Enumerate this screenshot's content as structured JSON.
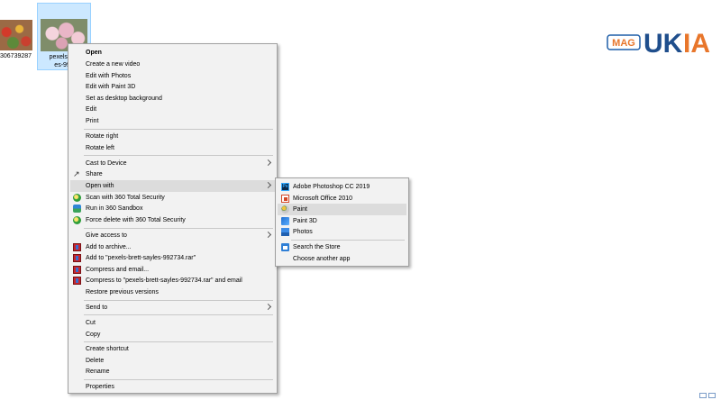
{
  "files": [
    {
      "name": "306739287"
    },
    {
      "name": "pexels-bre\nes-992"
    }
  ],
  "logo": {
    "text_mag": "MAG",
    "text_brand": "UKIA"
  },
  "context_menu": {
    "items": [
      {
        "label": "Open",
        "bold": true
      },
      {
        "label": "Create a new video"
      },
      {
        "label": "Edit with Photos"
      },
      {
        "label": "Edit with Paint 3D"
      },
      {
        "label": "Set as desktop background"
      },
      {
        "label": "Edit"
      },
      {
        "label": "Print"
      },
      {
        "label": "Rotate right"
      },
      {
        "label": "Rotate left"
      },
      {
        "label": "Cast to Device"
      },
      {
        "label": "Share"
      },
      {
        "label": "Open with"
      },
      {
        "label": "Scan with 360 Total Security"
      },
      {
        "label": "Run in 360 Sandbox"
      },
      {
        "label": "Force delete with 360 Total Security"
      },
      {
        "label": "Give access to"
      },
      {
        "label": "Add to archive..."
      },
      {
        "label": "Add to \"pexels-brett-sayles-992734.rar\""
      },
      {
        "label": "Compress and email..."
      },
      {
        "label": "Compress to \"pexels-brett-sayles-992734.rar\" and email"
      },
      {
        "label": "Restore previous versions"
      },
      {
        "label": "Send to"
      },
      {
        "label": "Cut"
      },
      {
        "label": "Copy"
      },
      {
        "label": "Create shortcut"
      },
      {
        "label": "Delete"
      },
      {
        "label": "Rename"
      },
      {
        "label": "Properties"
      }
    ]
  },
  "open_with_submenu": {
    "items": [
      {
        "label": "Adobe Photoshop CC 2019",
        "icon": "photoshop-icon"
      },
      {
        "label": "Microsoft Office 2010",
        "icon": "office-icon"
      },
      {
        "label": "Paint",
        "icon": "paint-icon",
        "highlighted": true
      },
      {
        "label": "Paint 3D",
        "icon": "paint-3d-icon"
      },
      {
        "label": "Photos",
        "icon": "photos-icon"
      },
      {
        "label": "Search the Store",
        "icon": "store-icon"
      },
      {
        "label": "Choose another app"
      }
    ]
  }
}
